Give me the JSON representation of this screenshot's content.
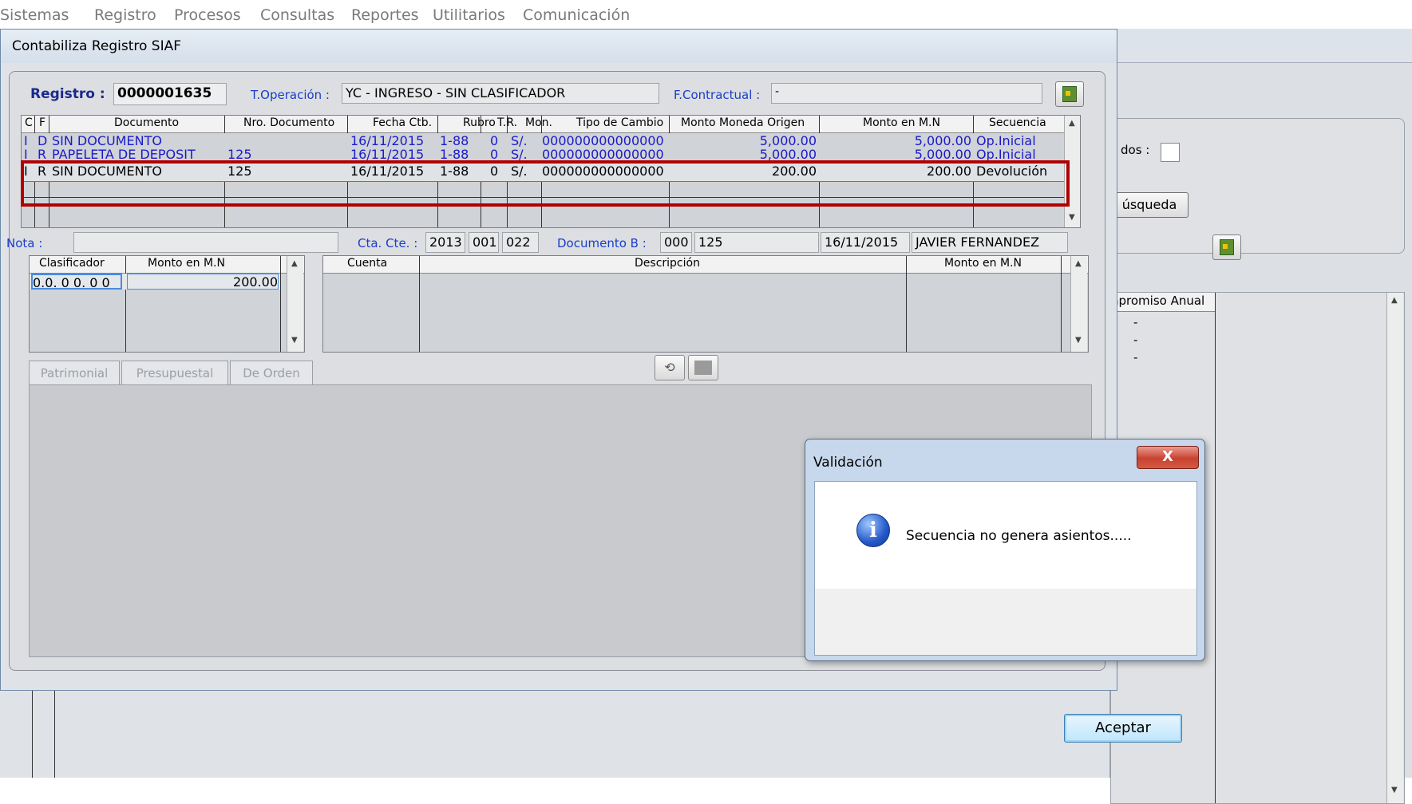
{
  "menu": [
    "Sistemas",
    "Registro",
    "Procesos",
    "Consultas",
    "Reportes",
    "Utilitarios",
    "Comunicación"
  ],
  "window": {
    "title": "Contabiliza Registro SIAF"
  },
  "header": {
    "registro_label": "Registro :",
    "registro_value": "0000001635",
    "toperacion_label": "T.Operación :",
    "toperacion_value": "YC - INGRESO - SIN CLASIFICADOR",
    "fcontractual_label": "F.Contractual :",
    "fcontractual_value": "-"
  },
  "docs_grid": {
    "columns": [
      "C",
      "F",
      "Documento",
      "Nro. Documento",
      "Fecha Ctb.",
      "Rubro",
      "T.R.",
      "Mon.",
      "Tipo de Cambio",
      "Monto Moneda Origen",
      "Monto en M.N",
      "Secuencia"
    ],
    "rows": [
      {
        "c": "I",
        "f": "D",
        "doc": "SIN DOCUMENTO",
        "nro": "",
        "fecha": "16/11/2015",
        "rubro": "1-88",
        "tr": "0",
        "mon": "S/.",
        "tc": "000000000000000",
        "orig": "5,000.00",
        "mn": "5,000.00",
        "sec": "Op.Inicial"
      },
      {
        "c": "I",
        "f": "R",
        "doc": "PAPELETA DE DEPOSIT",
        "nro": "125",
        "fecha": "16/11/2015",
        "rubro": "1-88",
        "tr": "0",
        "mon": "S/.",
        "tc": "000000000000000",
        "orig": "5,000.00",
        "mn": "5,000.00",
        "sec": "Op.Inicial"
      },
      {
        "c": "I",
        "f": "R",
        "doc": "SIN DOCUMENTO",
        "nro": "125",
        "fecha": "16/11/2015",
        "rubro": "1-88",
        "tr": "0",
        "mon": "S/.",
        "tc": "000000000000000",
        "orig": "200.00",
        "mn": "200.00",
        "sec": "Devolución"
      }
    ]
  },
  "nota": {
    "nota_label": "Nota :",
    "ctacte_label": "Cta. Cte. :",
    "ctacte_1": "2013",
    "ctacte_2": "001",
    "ctacte_3": "022",
    "docb_label": "Documento B :",
    "docb_1": "000",
    "docb_2": "125",
    "fecha": "16/11/2015",
    "nombre": "JAVIER FERNANDEZ"
  },
  "clasif_grid": {
    "columns": [
      "Clasificador",
      "Monto en M.N"
    ],
    "rows": [
      {
        "clasificador": "0.0. 0 0. 0 0",
        "monto": "200.00"
      }
    ]
  },
  "cuenta_grid": {
    "columns": [
      "Cuenta",
      "Descripción",
      "Monto en M.N"
    ]
  },
  "tabs": [
    "Patrimonial",
    "Presupuestal",
    "De Orden"
  ],
  "background_window": {
    "checkbox_label": "dos :",
    "search_button": "úsqueda",
    "column_header": "npromiso Anual",
    "dashes": [
      "-",
      "-",
      "-"
    ]
  },
  "dialog": {
    "title": "Validación",
    "close_label": "X",
    "message": "Secuencia no genera asientos.....",
    "ok_label": "Aceptar"
  },
  "colors": {
    "highlight": "#b10000",
    "text_blue": "#1a1ac8",
    "label_blue": "#1a3ec8"
  },
  "icons": [
    "exit-door-icon",
    "undo-icon",
    "stop-icon",
    "info-icon",
    "close-icon"
  ]
}
